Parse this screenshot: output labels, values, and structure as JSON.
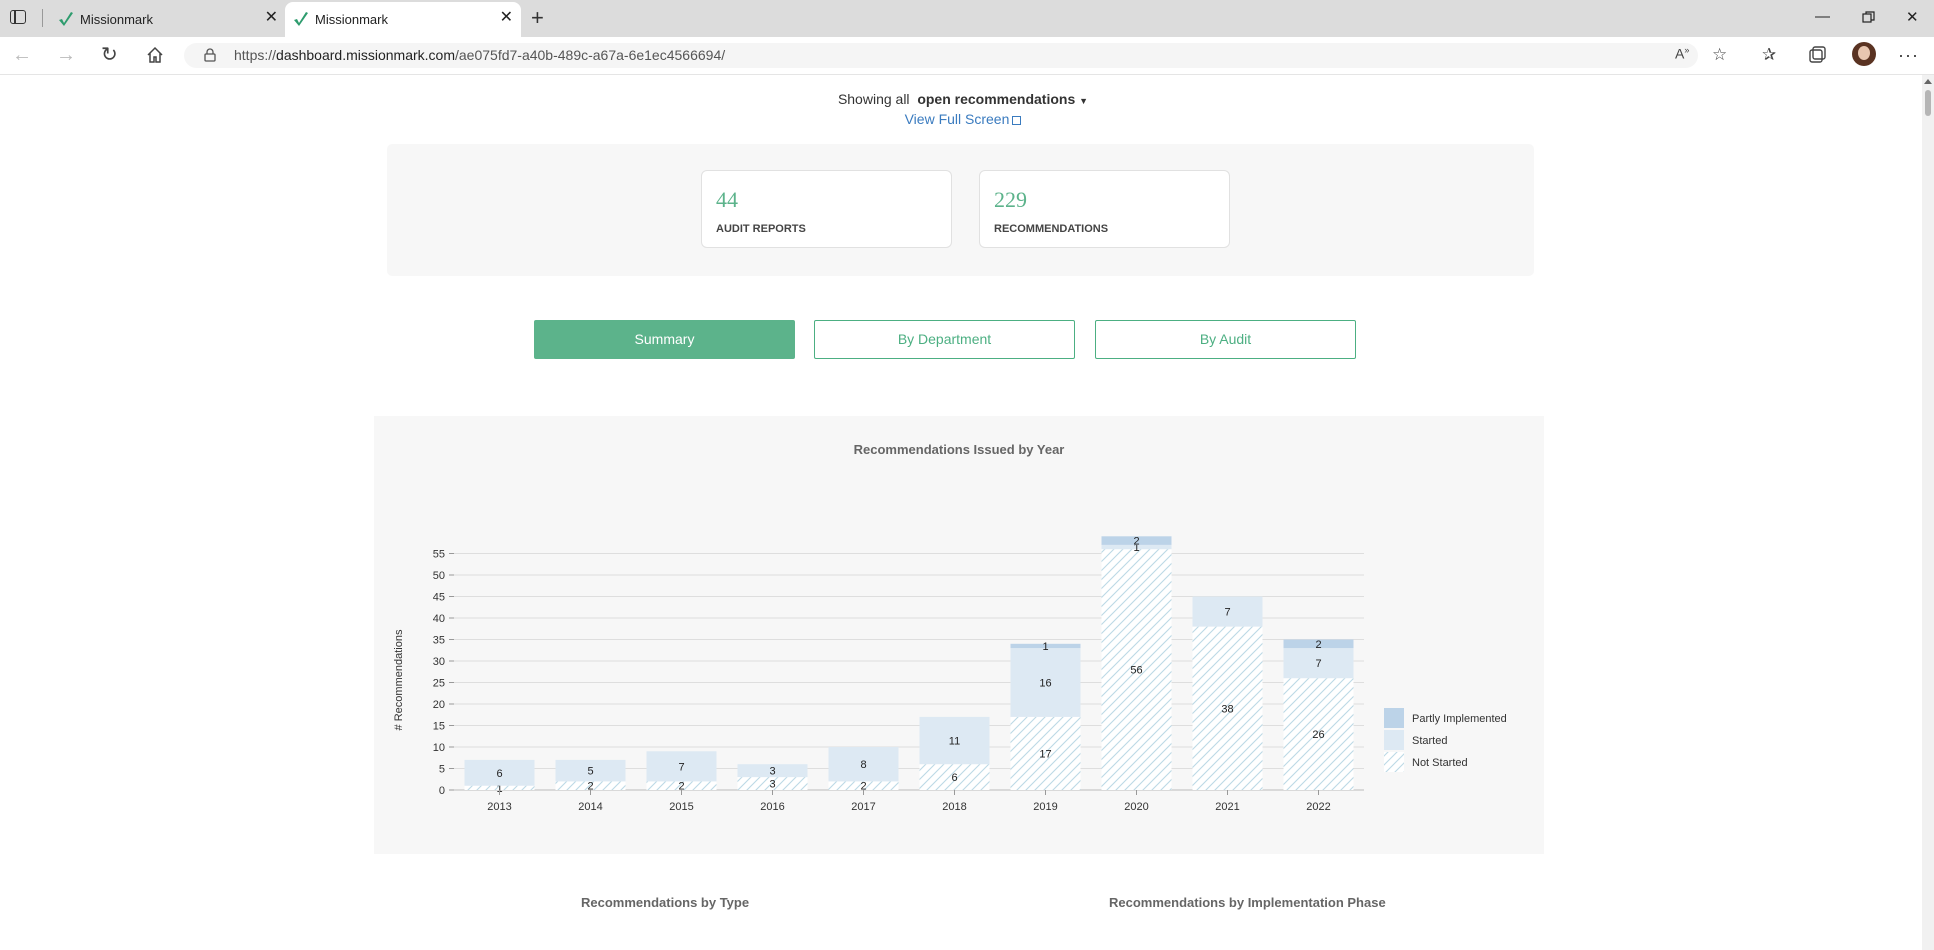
{
  "browser": {
    "tabs": [
      {
        "title": "Missionmark"
      },
      {
        "title": "Missionmark"
      }
    ],
    "url_prefix": "https://",
    "url_host": "dashboard.missionmark.com",
    "url_path": "/ae075fd7-a40b-489c-a67a-6e1ec4566694/"
  },
  "filter": {
    "showing_prefix": "Showing all",
    "selected_value": "open recommendations",
    "full_screen_label": "View Full Screen"
  },
  "stats": [
    {
      "value": "44",
      "label": "AUDIT REPORTS"
    },
    {
      "value": "229",
      "label": "RECOMMENDATIONS"
    }
  ],
  "view_tabs": {
    "summary": "Summary",
    "by_department": "By Department",
    "by_audit": "By Audit"
  },
  "colors": {
    "accent": "#5cb38b",
    "link": "#3a7bbf",
    "partly": "#bcd3e8",
    "started": "#dde9f3",
    "hatch": "#bcd9e6"
  },
  "chart_data": {
    "type": "bar",
    "title": "Recommendations Issued by Year",
    "ylabel": "# Recommendations",
    "xlabel": "",
    "stacked": true,
    "ylim": [
      0,
      60
    ],
    "yticks": [
      0,
      5,
      10,
      15,
      20,
      25,
      30,
      35,
      40,
      45,
      50,
      55
    ],
    "grid": true,
    "legend_position": "right",
    "categories": [
      "2013",
      "2014",
      "2015",
      "2016",
      "2017",
      "2018",
      "2019",
      "2020",
      "2021",
      "2022"
    ],
    "series": [
      {
        "name": "Not Started",
        "values": [
          1,
          2,
          2,
          3,
          2,
          6,
          17,
          56,
          38,
          26
        ]
      },
      {
        "name": "Started",
        "values": [
          6,
          5,
          7,
          3,
          8,
          11,
          16,
          1,
          7,
          7
        ]
      },
      {
        "name": "Partly Implemented",
        "values": [
          0,
          0,
          0,
          0,
          0,
          0,
          1,
          2,
          0,
          2
        ]
      }
    ],
    "legend": [
      "Partly Implemented",
      "Started",
      "Not Started"
    ]
  },
  "sections": {
    "by_type": "Recommendations by Type",
    "by_phase": "Recommendations by Implementation Phase"
  }
}
